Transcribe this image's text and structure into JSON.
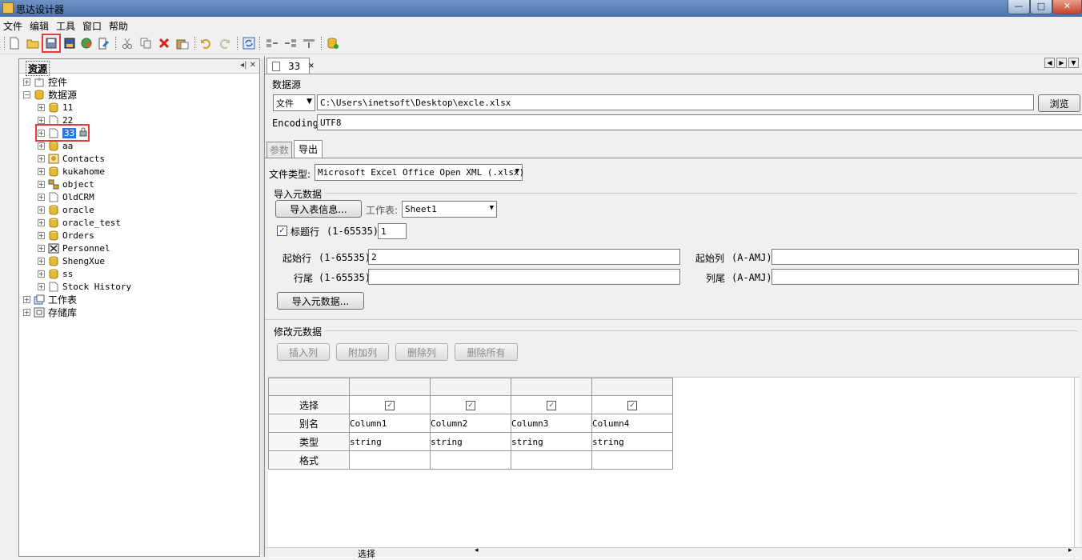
{
  "window": {
    "title": "思达设计器",
    "min": "—",
    "max": "□",
    "close": "✕"
  },
  "menu": [
    "文件",
    "编辑",
    "工具",
    "窗口",
    "帮助"
  ],
  "toolbar_icons": [
    "new-file-icon",
    "open-folder-icon",
    "save-icon",
    "save-all-icon",
    "refresh-data-icon",
    "edit-icon",
    "cut-icon",
    "copy-icon",
    "delete-icon",
    "paste-icon",
    "undo-icon",
    "redo-icon",
    "sync-icon",
    "layout-left-icon",
    "layout-right-icon",
    "layout-center-icon",
    "database-connect-icon"
  ],
  "left": {
    "title": "资源",
    "ctrl": "◂|  ✕",
    "tree": [
      {
        "label": "控件",
        "level": 0,
        "icon": "widget-icon"
      },
      {
        "label": "数据源",
        "level": 0,
        "icon": "datasource-icon",
        "expanded": true
      },
      {
        "label": "11",
        "level": 1,
        "icon": "database-icon"
      },
      {
        "label": "22",
        "level": 1,
        "icon": "file-icon"
      },
      {
        "label": "33",
        "level": 1,
        "icon": "file-icon",
        "selected": true
      },
      {
        "label": "aa",
        "level": 1,
        "icon": "database-icon"
      },
      {
        "label": "Contacts",
        "level": 1,
        "icon": "contacts-icon"
      },
      {
        "label": "kukahome",
        "level": 1,
        "icon": "database-icon"
      },
      {
        "label": "object",
        "level": 1,
        "icon": "object-icon"
      },
      {
        "label": "OldCRM",
        "level": 1,
        "icon": "file-icon"
      },
      {
        "label": "oracle",
        "level": 1,
        "icon": "database-icon"
      },
      {
        "label": "oracle_test",
        "level": 1,
        "icon": "database-icon"
      },
      {
        "label": "Orders",
        "level": 1,
        "icon": "database-icon"
      },
      {
        "label": "Personnel",
        "level": 1,
        "icon": "excel-icon"
      },
      {
        "label": "ShengXue",
        "level": 1,
        "icon": "database-icon"
      },
      {
        "label": "ss",
        "level": 1,
        "icon": "database-icon"
      },
      {
        "label": "Stock History",
        "level": 1,
        "icon": "file-icon"
      },
      {
        "label": "工作表",
        "level": 0,
        "icon": "worksheet-icon"
      },
      {
        "label": "存储库",
        "level": 0,
        "icon": "repository-icon"
      }
    ]
  },
  "doc": {
    "tab_label": "33",
    "datasource_section": "数据源",
    "source_type": "文件",
    "file_path": "C:\\Users\\inetsoft\\Desktop\\excle.xlsx",
    "browse_label": "浏览",
    "encoding_label": "Encoding:",
    "encoding_value": "UTF8",
    "subtabs": [
      "参数",
      "导出"
    ],
    "file_type_label": "文件类型:",
    "file_type_value": "Microsoft Excel Office Open XML (.xlsx)",
    "import_meta_section": "导入元数据",
    "import_table_info": "导入表信息...",
    "worksheet_label": "工作表:",
    "worksheet_value": "Sheet1",
    "header_row_label": "标题行",
    "header_row_range": "(1-65535):",
    "header_row_value": "1",
    "start_row_label": "起始行",
    "start_row_range": "(1-65535):",
    "start_row_value": "2",
    "start_col_label": "起始列",
    "start_col_range": "(A-AMJ):",
    "start_col_value": "",
    "end_row_label": "行尾",
    "end_row_range": "(1-65535):",
    "end_row_value": "",
    "end_col_label": "列尾",
    "end_col_range": "(A-AMJ):",
    "end_col_value": "",
    "import_meta_button": "导入元数据...",
    "modify_meta_section": "修改元数据",
    "insert_col": "插入列",
    "append_col": "附加列",
    "delete_col": "删除列",
    "delete_all": "删除所有",
    "grid": {
      "row_headers": [
        "选择",
        "别名",
        "类型",
        "格式"
      ],
      "columns": [
        {
          "alias": "Column1",
          "type": "string",
          "format": "",
          "selected": true
        },
        {
          "alias": "Column2",
          "type": "string",
          "format": "",
          "selected": true
        },
        {
          "alias": "Column3",
          "type": "string",
          "format": "",
          "selected": true
        },
        {
          "alias": "Column4",
          "type": "string",
          "format": "",
          "selected": true
        }
      ]
    },
    "bottom_label": "选择"
  }
}
